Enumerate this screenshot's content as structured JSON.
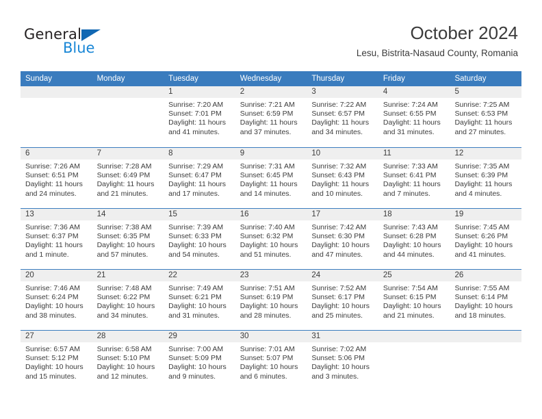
{
  "brand": {
    "name_part1": "General",
    "name_part2": "Blue",
    "triangle_color": "#1268b3",
    "blue_color": "#1886d6"
  },
  "header": {
    "title": "October 2024",
    "subtitle": "Lesu, Bistrita-Nasaud County, Romania"
  },
  "theme": {
    "header_blue": "#3a7cbe",
    "daynum_band": "#efefef",
    "text": "#3b3b3b"
  },
  "calendar": {
    "day_headers": [
      "Sunday",
      "Monday",
      "Tuesday",
      "Wednesday",
      "Thursday",
      "Friday",
      "Saturday"
    ],
    "weeks": [
      [
        {
          "day": "",
          "sunrise": "",
          "sunset": "",
          "daylight": "",
          "daylight2": ""
        },
        {
          "day": "",
          "sunrise": "",
          "sunset": "",
          "daylight": "",
          "daylight2": ""
        },
        {
          "day": "1",
          "sunrise": "Sunrise: 7:20 AM",
          "sunset": "Sunset: 7:01 PM",
          "daylight": "Daylight: 11 hours",
          "daylight2": "and 41 minutes."
        },
        {
          "day": "2",
          "sunrise": "Sunrise: 7:21 AM",
          "sunset": "Sunset: 6:59 PM",
          "daylight": "Daylight: 11 hours",
          "daylight2": "and 37 minutes."
        },
        {
          "day": "3",
          "sunrise": "Sunrise: 7:22 AM",
          "sunset": "Sunset: 6:57 PM",
          "daylight": "Daylight: 11 hours",
          "daylight2": "and 34 minutes."
        },
        {
          "day": "4",
          "sunrise": "Sunrise: 7:24 AM",
          "sunset": "Sunset: 6:55 PM",
          "daylight": "Daylight: 11 hours",
          "daylight2": "and 31 minutes."
        },
        {
          "day": "5",
          "sunrise": "Sunrise: 7:25 AM",
          "sunset": "Sunset: 6:53 PM",
          "daylight": "Daylight: 11 hours",
          "daylight2": "and 27 minutes."
        }
      ],
      [
        {
          "day": "6",
          "sunrise": "Sunrise: 7:26 AM",
          "sunset": "Sunset: 6:51 PM",
          "daylight": "Daylight: 11 hours",
          "daylight2": "and 24 minutes."
        },
        {
          "day": "7",
          "sunrise": "Sunrise: 7:28 AM",
          "sunset": "Sunset: 6:49 PM",
          "daylight": "Daylight: 11 hours",
          "daylight2": "and 21 minutes."
        },
        {
          "day": "8",
          "sunrise": "Sunrise: 7:29 AM",
          "sunset": "Sunset: 6:47 PM",
          "daylight": "Daylight: 11 hours",
          "daylight2": "and 17 minutes."
        },
        {
          "day": "9",
          "sunrise": "Sunrise: 7:31 AM",
          "sunset": "Sunset: 6:45 PM",
          "daylight": "Daylight: 11 hours",
          "daylight2": "and 14 minutes."
        },
        {
          "day": "10",
          "sunrise": "Sunrise: 7:32 AM",
          "sunset": "Sunset: 6:43 PM",
          "daylight": "Daylight: 11 hours",
          "daylight2": "and 10 minutes."
        },
        {
          "day": "11",
          "sunrise": "Sunrise: 7:33 AM",
          "sunset": "Sunset: 6:41 PM",
          "daylight": "Daylight: 11 hours",
          "daylight2": "and 7 minutes."
        },
        {
          "day": "12",
          "sunrise": "Sunrise: 7:35 AM",
          "sunset": "Sunset: 6:39 PM",
          "daylight": "Daylight: 11 hours",
          "daylight2": "and 4 minutes."
        }
      ],
      [
        {
          "day": "13",
          "sunrise": "Sunrise: 7:36 AM",
          "sunset": "Sunset: 6:37 PM",
          "daylight": "Daylight: 11 hours",
          "daylight2": "and 1 minute."
        },
        {
          "day": "14",
          "sunrise": "Sunrise: 7:38 AM",
          "sunset": "Sunset: 6:35 PM",
          "daylight": "Daylight: 10 hours",
          "daylight2": "and 57 minutes."
        },
        {
          "day": "15",
          "sunrise": "Sunrise: 7:39 AM",
          "sunset": "Sunset: 6:33 PM",
          "daylight": "Daylight: 10 hours",
          "daylight2": "and 54 minutes."
        },
        {
          "day": "16",
          "sunrise": "Sunrise: 7:40 AM",
          "sunset": "Sunset: 6:32 PM",
          "daylight": "Daylight: 10 hours",
          "daylight2": "and 51 minutes."
        },
        {
          "day": "17",
          "sunrise": "Sunrise: 7:42 AM",
          "sunset": "Sunset: 6:30 PM",
          "daylight": "Daylight: 10 hours",
          "daylight2": "and 47 minutes."
        },
        {
          "day": "18",
          "sunrise": "Sunrise: 7:43 AM",
          "sunset": "Sunset: 6:28 PM",
          "daylight": "Daylight: 10 hours",
          "daylight2": "and 44 minutes."
        },
        {
          "day": "19",
          "sunrise": "Sunrise: 7:45 AM",
          "sunset": "Sunset: 6:26 PM",
          "daylight": "Daylight: 10 hours",
          "daylight2": "and 41 minutes."
        }
      ],
      [
        {
          "day": "20",
          "sunrise": "Sunrise: 7:46 AM",
          "sunset": "Sunset: 6:24 PM",
          "daylight": "Daylight: 10 hours",
          "daylight2": "and 38 minutes."
        },
        {
          "day": "21",
          "sunrise": "Sunrise: 7:48 AM",
          "sunset": "Sunset: 6:22 PM",
          "daylight": "Daylight: 10 hours",
          "daylight2": "and 34 minutes."
        },
        {
          "day": "22",
          "sunrise": "Sunrise: 7:49 AM",
          "sunset": "Sunset: 6:21 PM",
          "daylight": "Daylight: 10 hours",
          "daylight2": "and 31 minutes."
        },
        {
          "day": "23",
          "sunrise": "Sunrise: 7:51 AM",
          "sunset": "Sunset: 6:19 PM",
          "daylight": "Daylight: 10 hours",
          "daylight2": "and 28 minutes."
        },
        {
          "day": "24",
          "sunrise": "Sunrise: 7:52 AM",
          "sunset": "Sunset: 6:17 PM",
          "daylight": "Daylight: 10 hours",
          "daylight2": "and 25 minutes."
        },
        {
          "day": "25",
          "sunrise": "Sunrise: 7:54 AM",
          "sunset": "Sunset: 6:15 PM",
          "daylight": "Daylight: 10 hours",
          "daylight2": "and 21 minutes."
        },
        {
          "day": "26",
          "sunrise": "Sunrise: 7:55 AM",
          "sunset": "Sunset: 6:14 PM",
          "daylight": "Daylight: 10 hours",
          "daylight2": "and 18 minutes."
        }
      ],
      [
        {
          "day": "27",
          "sunrise": "Sunrise: 6:57 AM",
          "sunset": "Sunset: 5:12 PM",
          "daylight": "Daylight: 10 hours",
          "daylight2": "and 15 minutes."
        },
        {
          "day": "28",
          "sunrise": "Sunrise: 6:58 AM",
          "sunset": "Sunset: 5:10 PM",
          "daylight": "Daylight: 10 hours",
          "daylight2": "and 12 minutes."
        },
        {
          "day": "29",
          "sunrise": "Sunrise: 7:00 AM",
          "sunset": "Sunset: 5:09 PM",
          "daylight": "Daylight: 10 hours",
          "daylight2": "and 9 minutes."
        },
        {
          "day": "30",
          "sunrise": "Sunrise: 7:01 AM",
          "sunset": "Sunset: 5:07 PM",
          "daylight": "Daylight: 10 hours",
          "daylight2": "and 6 minutes."
        },
        {
          "day": "31",
          "sunrise": "Sunrise: 7:02 AM",
          "sunset": "Sunset: 5:06 PM",
          "daylight": "Daylight: 10 hours",
          "daylight2": "and 3 minutes."
        },
        {
          "day": "",
          "sunrise": "",
          "sunset": "",
          "daylight": "",
          "daylight2": ""
        },
        {
          "day": "",
          "sunrise": "",
          "sunset": "",
          "daylight": "",
          "daylight2": ""
        }
      ]
    ]
  }
}
